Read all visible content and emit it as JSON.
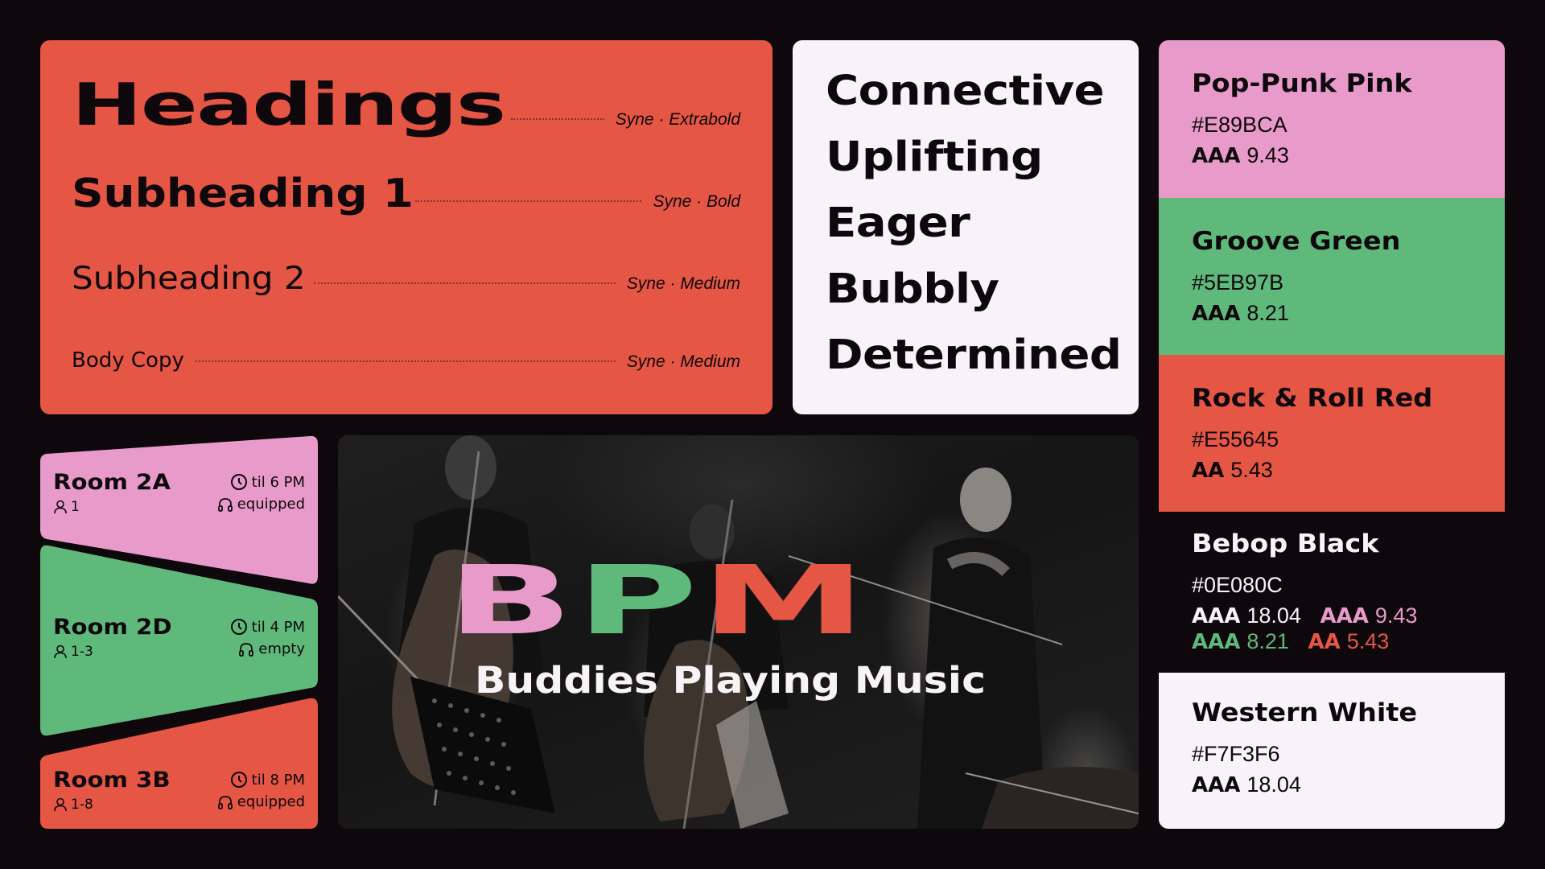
{
  "typography": {
    "rows": [
      {
        "name": "Headings",
        "spec": "Syne · Extrabold"
      },
      {
        "name": "Subheading 1",
        "spec": "Syne · Bold"
      },
      {
        "name": "Subheading 2",
        "spec": "Syne · Medium"
      },
      {
        "name": "Body Copy",
        "spec": "Syne · Medium"
      }
    ]
  },
  "adjectives": [
    "Connective",
    "Uplifting",
    "Eager",
    "Bubbly",
    "Determined"
  ],
  "swatches": {
    "pink": {
      "name": "Pop-Punk Pink",
      "hex": "#E89BCA",
      "level": "AAA",
      "ratio": "9.43"
    },
    "green": {
      "name": "Groove Green",
      "hex": "#5EB97B",
      "level": "AAA",
      "ratio": "8.21"
    },
    "red": {
      "name": "Rock & Roll Red",
      "hex": "#E55645",
      "level": "AA",
      "ratio": "5.43"
    },
    "black": {
      "name": "Bebop Black",
      "hex": "#0E080C",
      "pairs": [
        {
          "level": "AAA",
          "ratio": "18.04",
          "color": "#F7F3F6"
        },
        {
          "level": "AAA",
          "ratio": "9.43",
          "color": "#E89BCA"
        },
        {
          "level": "AAA",
          "ratio": "8.21",
          "color": "#5EB97B"
        },
        {
          "level": "AA",
          "ratio": "5.43",
          "color": "#E55645"
        }
      ]
    },
    "white": {
      "name": "Western White",
      "hex": "#F7F3F6",
      "level": "AAA",
      "ratio": "18.04"
    }
  },
  "rooms": [
    {
      "name": "Room 2A",
      "capacity": "1",
      "until": "til 6 PM",
      "status": "equipped",
      "color": "#E89BCA"
    },
    {
      "name": "Room 2D",
      "capacity": "1-3",
      "until": "til 4 PM",
      "status": "empty",
      "color": "#5EB97B"
    },
    {
      "name": "Room 3B",
      "capacity": "1-8",
      "until": "til 8 PM",
      "status": "equipped",
      "color": "#E55645"
    }
  ],
  "hero": {
    "logo_b": "B",
    "logo_p": "P",
    "logo_m": "M",
    "tagline": "Buddies Playing Music"
  },
  "icons": {
    "capacity": "person-icon",
    "time": "clock-icon",
    "status": "headphones-icon"
  },
  "colors": {
    "background": "#0E080C",
    "pink": "#E89BCA",
    "green": "#5EB97B",
    "red": "#E55645",
    "white": "#F7F3F6"
  }
}
